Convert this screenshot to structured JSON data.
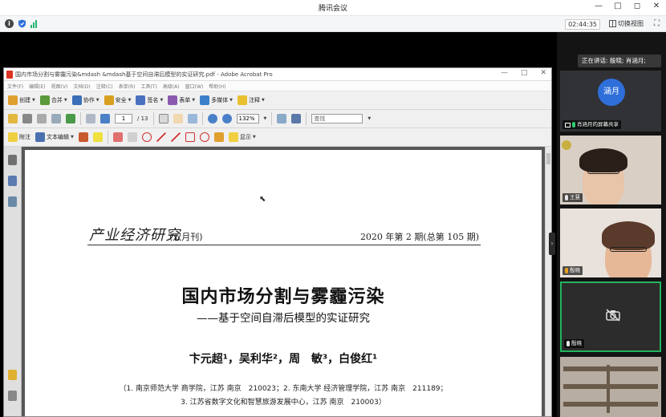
{
  "window": {
    "title": "腾讯会议",
    "controls": [
      "—",
      "□",
      "◻",
      "✕"
    ]
  },
  "status": {
    "timer": "02:44:35",
    "view_switch": "切换视图"
  },
  "acrobat": {
    "title": "国内市场分割与雾霾污染&mdash &mdash基于空间自滞后模型的实证研究.pdf - Adobe Acrobat Pro",
    "menu": [
      "文件(F)",
      "编辑(E)",
      "视图(V)",
      "文档(D)",
      "注释(C)",
      "表单(R)",
      "工具(T)",
      "高级(A)",
      "窗口(W)",
      "帮助(H)"
    ],
    "toolbar1": {
      "create": "创建",
      "combine": "合并",
      "collaborate": "协作",
      "secure": "安全",
      "sign": "签名",
      "forms": "表单",
      "multimedia": "多媒体",
      "comment": "注释"
    },
    "toolbar2": {
      "page_current": "1",
      "page_total": "/ 13",
      "zoom": "132%",
      "find_placeholder": "查找"
    },
    "toolbar3": {
      "sticky": "附注",
      "text_edit": "文本编辑",
      "show": "显示"
    }
  },
  "pdf": {
    "journal_logo": "产业经济研究",
    "journal_freq": "(双月刊)",
    "issue": "2020 年第 2 期(总第 105 期)",
    "title": "国内市场分割与雾霾污染",
    "subtitle": "——基于空间自滞后模型的实证研究",
    "authors": "卞元超¹，吴利华²，周　敏³，白俊红¹",
    "affiliation_1": "（1. 南京师范大学 商学院，江苏 南京　210023；2. 东南大学 经济管理学院，江苏 南京　211189；",
    "affiliation_2": "3. 江苏省数字文化和智慧旅游发展中心，江苏 南京　210003）"
  },
  "participants": {
    "speaking": "正在讲话: 殷晓; 肖涵月;",
    "tiles": [
      {
        "avatar_text": "涵月",
        "label": "肖涵月的屏幕共享"
      },
      {
        "label": "王慧"
      },
      {
        "label": "殷晓"
      },
      {
        "label": "殷晓"
      },
      {
        "label": ""
      }
    ]
  },
  "colors": {
    "accent_blue": "#2f6fd9",
    "active_green": "#23b35f"
  }
}
